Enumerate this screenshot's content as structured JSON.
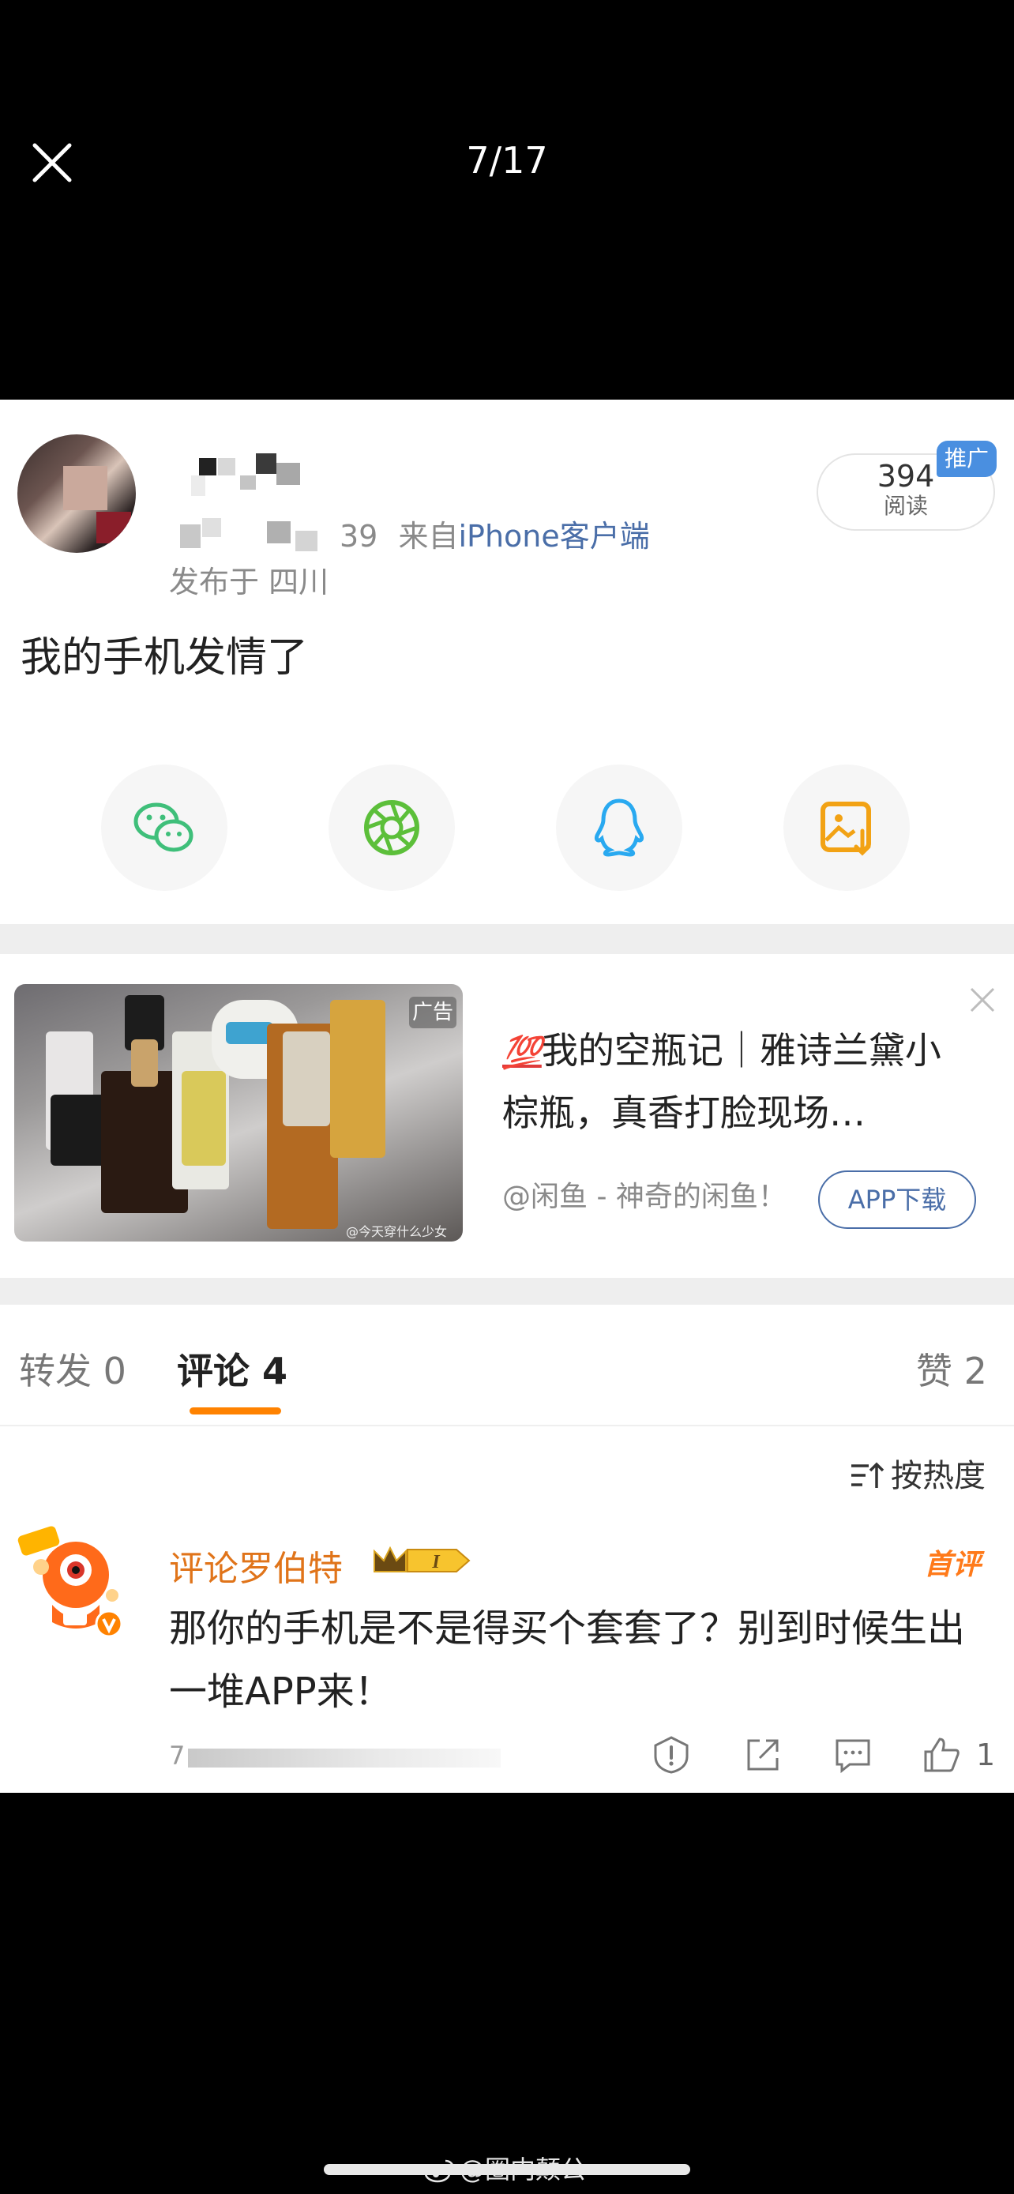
{
  "viewer": {
    "counter": "7/17"
  },
  "post": {
    "meta_suffix": "39",
    "source_prefix": "来自",
    "source": "iPhone客户端",
    "location": "发布于 四川",
    "read_count": "394",
    "read_label": "阅读",
    "promo_tag": "推广",
    "text": "我的手机发情了"
  },
  "share": [
    "wechat-icon",
    "moments-icon",
    "qq-icon",
    "save-image-icon"
  ],
  "ad": {
    "tag": "广告",
    "title_icon": "💯",
    "title": "我的空瓶记｜雅诗兰黛小棕瓶，真香打脸现场…",
    "source": "@闲鱼 - 神奇的闲鱼！",
    "download_label": "APP下载",
    "image_watermark": "@今天穿什么少女"
  },
  "tabs": {
    "repost": "转发 0",
    "comment": "评论 4",
    "like": "赞 2"
  },
  "sort_label": "按热度",
  "comment": {
    "username": "评论罗伯特",
    "level": "I",
    "first_tag": "首评",
    "text": "那你的手机是不是得买个套套了？别到时候生出一堆APP来！",
    "time_prefix": "7",
    "like_count": "1"
  },
  "watermark": "@圈内颠公",
  "colors": {
    "accent_orange": "#ff8200",
    "link_blue": "#4a6ea8",
    "promo_blue": "#4a8fe0",
    "username_orange": "#e0741a"
  }
}
